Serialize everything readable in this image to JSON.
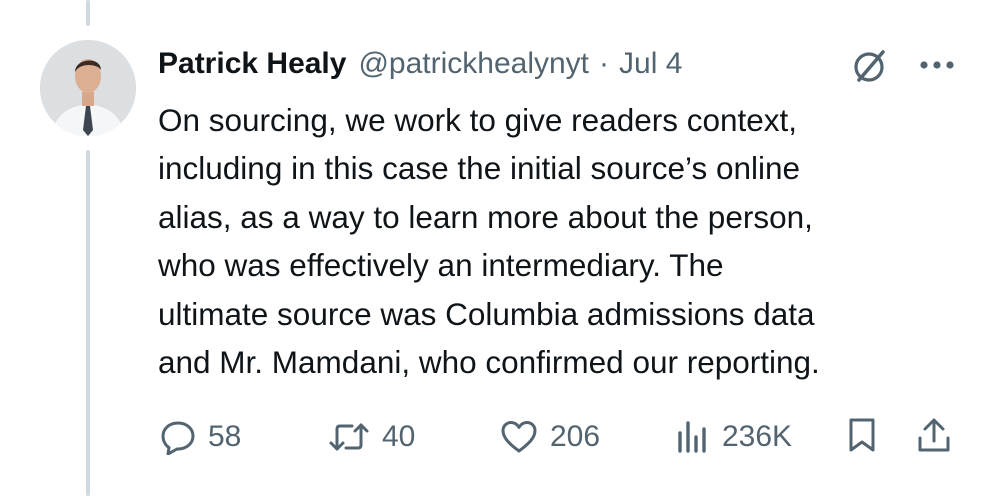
{
  "tweet": {
    "author_name": "Patrick Healy",
    "handle": "@patrickhealynyt",
    "separator": "·",
    "date": "Jul 4",
    "text_lines": [
      "On sourcing, we work to give readers context,",
      "including in this case the initial source’s online",
      "alias, as a way to learn more about the person,",
      "who was effectively an intermediary. The",
      "ultimate source was Columbia admissions data",
      "and Mr. Mamdani, who confirmed our reporting."
    ]
  },
  "actions": {
    "replies": "58",
    "reposts": "40",
    "likes": "206",
    "views": "236K"
  },
  "icons": {
    "header": [
      "grok-icon",
      "more-icon"
    ],
    "action_bar": [
      "reply-icon",
      "repost-icon",
      "like-icon",
      "views-icon",
      "bookmark-icon",
      "share-icon"
    ]
  },
  "colors": {
    "text": "#0f1419",
    "secondary": "#536471",
    "thread_line": "#cfd9de"
  }
}
